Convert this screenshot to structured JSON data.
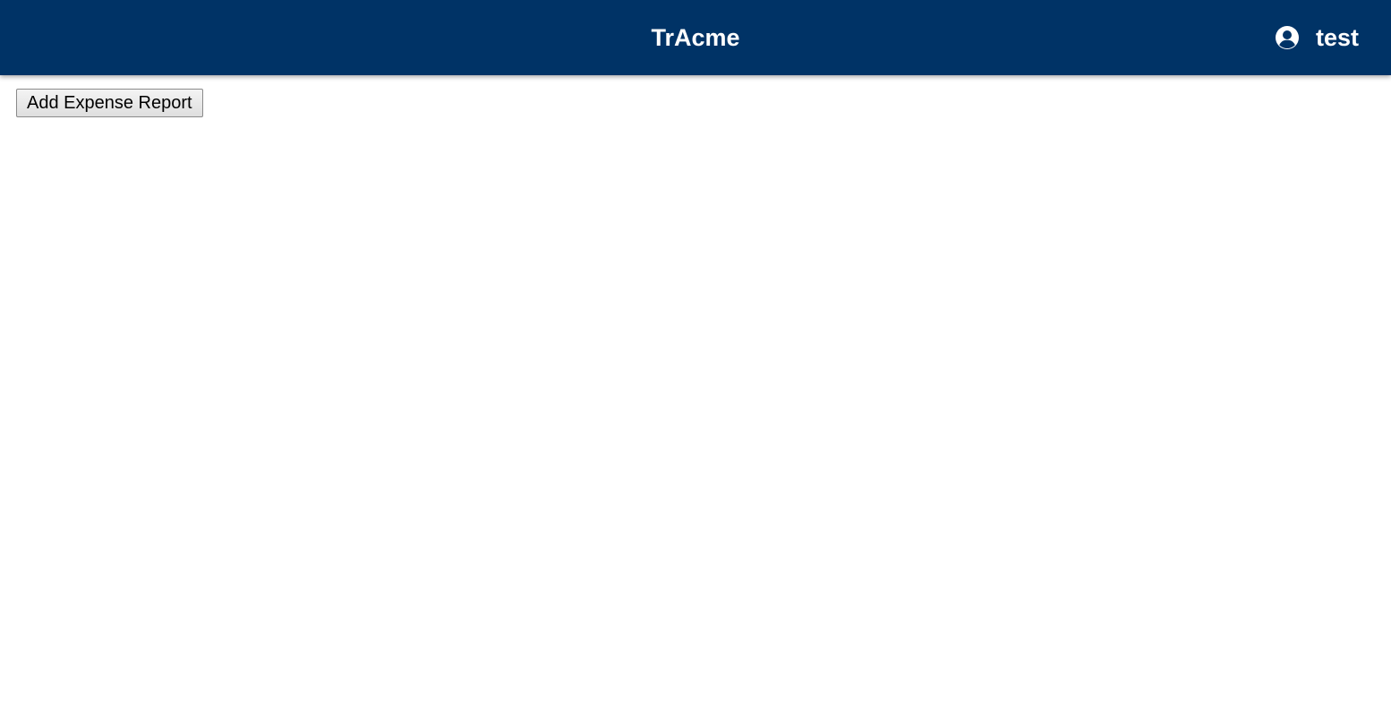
{
  "header": {
    "title": "TrAcme",
    "user": {
      "name": "test",
      "icon": "user-circle-icon"
    },
    "background_color": "#003366",
    "text_color": "#ffffff"
  },
  "main": {
    "add_expense_label": "Add Expense Report"
  }
}
